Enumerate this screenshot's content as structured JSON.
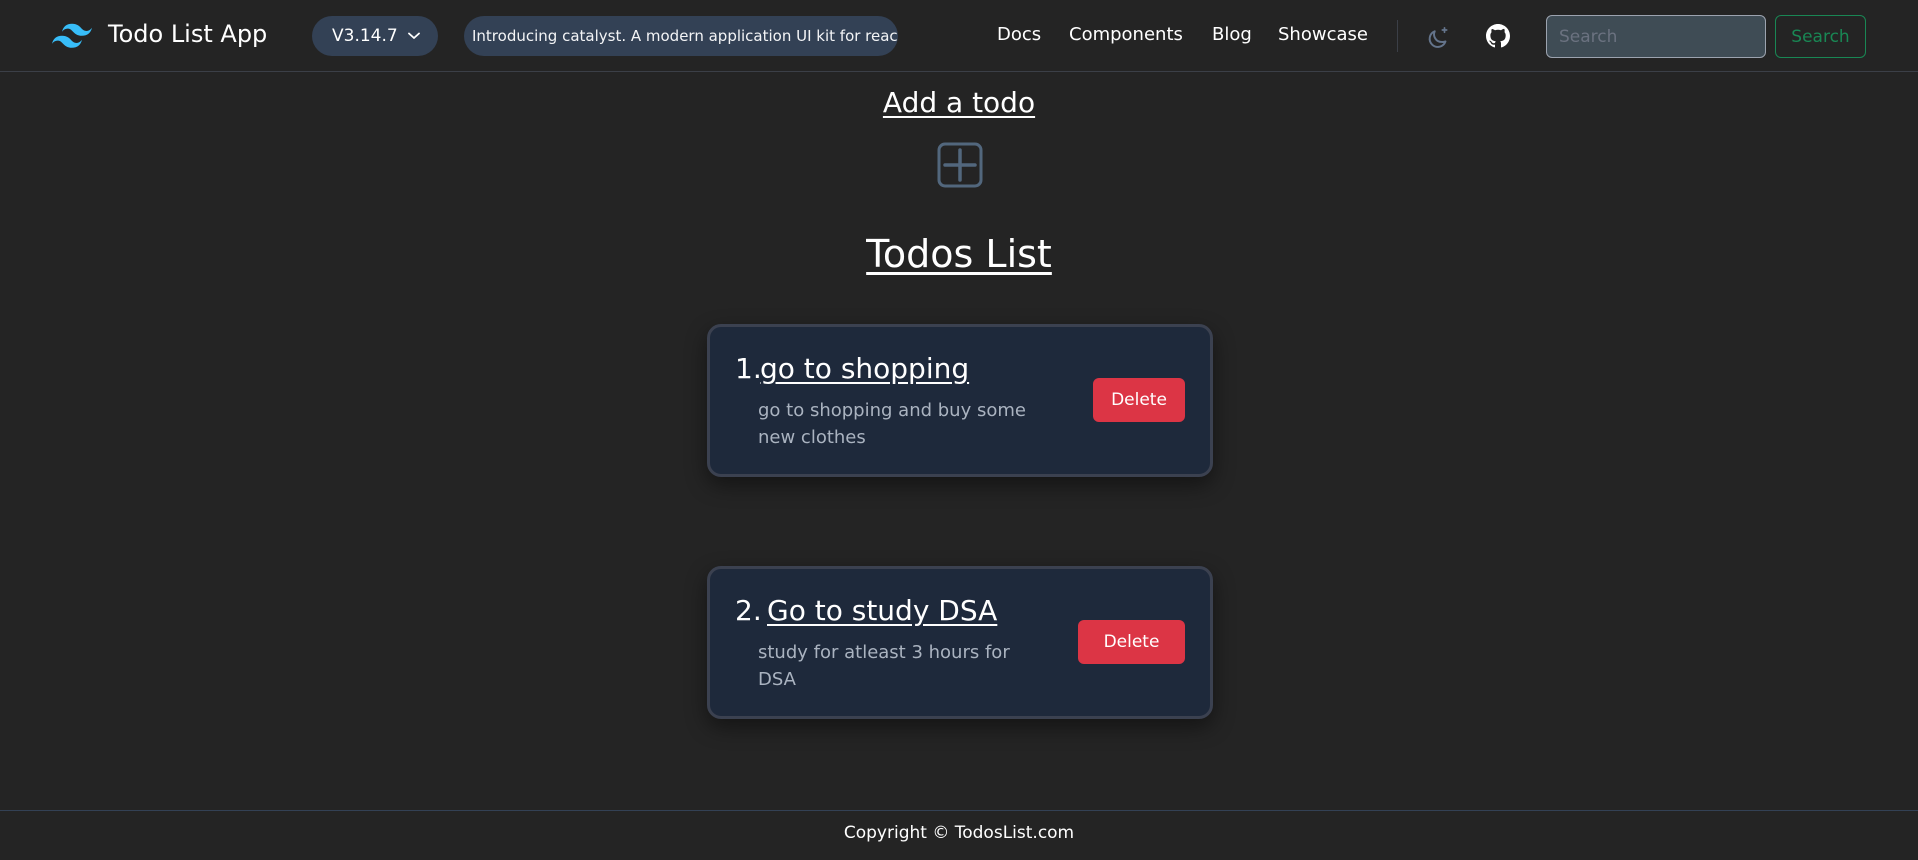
{
  "header": {
    "app_title": "Todo List App",
    "logo_icon": "tailwind-waves-icon",
    "version_label": "V3.14.7",
    "announcement": "Introducing catalyst. A modern application UI kit for react",
    "nav": {
      "docs": "Docs",
      "components": "Components",
      "blog": "Blog",
      "showcase": "Showcase"
    },
    "theme_icon": "moon-icon",
    "github_icon": "github-icon",
    "search_placeholder": "Search",
    "search_button": "Search"
  },
  "main": {
    "add_heading": "Add a todo",
    "add_icon": "plus-square-icon",
    "list_heading": "Todos List",
    "todos": [
      {
        "number": "1.",
        "title": "go to shopping",
        "description": "go to shopping and buy some new clothes",
        "delete_label": "Delete"
      },
      {
        "number": "2.",
        "title": "Go to study DSA",
        "description": "study for atleast 3 hours for DSA",
        "delete_label": "Delete"
      }
    ]
  },
  "footer": {
    "copyright": "Copyright © TodosList.com"
  },
  "colors": {
    "background": "#242424",
    "card": "#1e293b",
    "danger": "#dc3545",
    "success": "#198754",
    "accent": "#38bdf8",
    "pill": "#334155"
  }
}
